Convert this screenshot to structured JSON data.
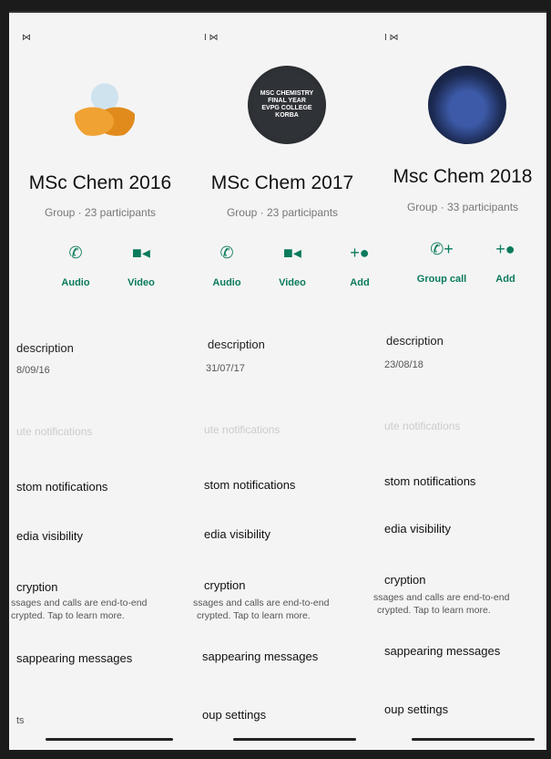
{
  "columns": [
    {
      "status_glyph": "⋈",
      "title": "MSc Chem 2016",
      "subtitle": "Group · 23 participants",
      "actions": [
        {
          "label": "Audio",
          "icon": "phone-icon"
        },
        {
          "label": "Video",
          "icon": "video-icon"
        }
      ],
      "description_header": "description",
      "description_date": "8/09/16",
      "mute_notifications": "ute notifications",
      "custom_notifications": "stom notifications",
      "media_visibility": "edia visibility",
      "encryption_title": "cryption",
      "disappearing_messages": "sappearing messages",
      "bottom_item": "ts"
    },
    {
      "status_glyph": "I ⋈",
      "title": "MSc Chem 2017",
      "subtitle": "Group · 23 participants",
      "avatar_text": "MSC CHEMISTRY FINAL YEAR EVPG COLLEGE KORBA",
      "actions": [
        {
          "label": "Audio",
          "icon": "phone-icon"
        },
        {
          "label": "Video",
          "icon": "video-icon"
        },
        {
          "label": "Add",
          "icon": "add-person-icon"
        }
      ],
      "description_header": "description",
      "description_date": "31/07/17",
      "mute_notifications": "ute notifications",
      "custom_notifications": "stom notifications",
      "media_visibility": "edia visibility",
      "encryption_title": "cryption",
      "disappearing_messages": "sappearing messages",
      "bottom_item": "oup settings"
    },
    {
      "status_glyph": "I ⋈",
      "title": "Msc Chem 2018",
      "subtitle": "Group · 33 participants",
      "actions": [
        {
          "label": "Group call",
          "icon": "group-call-icon"
        },
        {
          "label": "Add",
          "icon": "add-person-icon"
        }
      ],
      "description_header": "description",
      "description_date": "23/08/18",
      "mute_notifications": "ute notifications",
      "custom_notifications": "stom notifications",
      "media_visibility": "edia visibility",
      "encryption_title": "cryption",
      "disappearing_messages": "sappearing messages",
      "bottom_item": "oup settings"
    }
  ],
  "encryption_body": {
    "line1a": "ssages and calls are end-to-end",
    "line1b": "ssages and calls are end-to-end",
    "line1c": "ssages and calls are end-to-end",
    "line2a": "crypted. Tap to learn more.",
    "line2b": "crypted. Tap to learn more.",
    "line2c": "crypted. Tap to learn more."
  },
  "colors": {
    "accent": "#0a7a5c",
    "background": "#f4f4f4",
    "muted": "#777777"
  }
}
